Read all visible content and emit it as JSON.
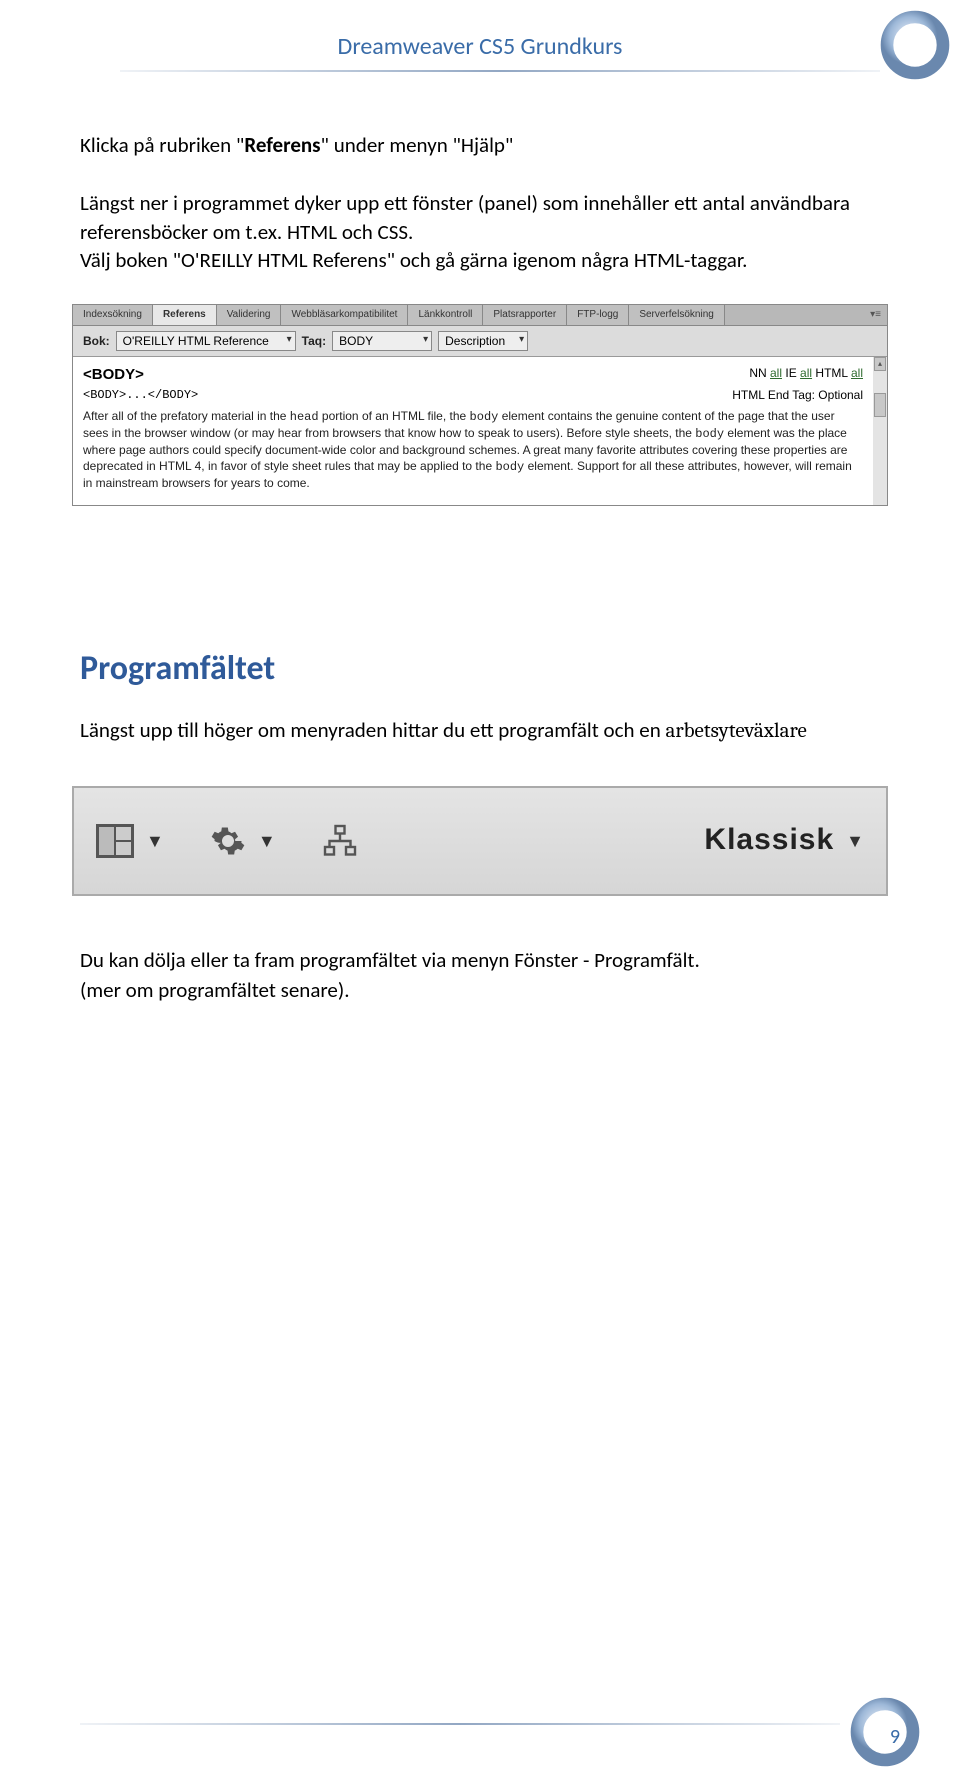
{
  "header": {
    "title": "Dreamweaver CS5 Grundkurs"
  },
  "intro": {
    "line1_a": "Klicka på rubriken \"",
    "line1_bold": "Referens",
    "line1_b": "\" under menyn \"Hjälp\"",
    "para2": "Längst ner i programmet dyker upp ett fönster (panel) som innehåller ett antal användbara referensböcker om t.ex. HTML och CSS.",
    "para3": "Välj boken \"O'REILLY HTML Referens\" och gå gärna igenom några HTML-taggar."
  },
  "panel": {
    "tabs": [
      "Indexsökning",
      "Referens",
      "Validering",
      "Webbläsarkompatibilitet",
      "Länkkontroll",
      "Platsrapporter",
      "FTP-logg",
      "Serverfelsökning"
    ],
    "activeTab": 1,
    "bokLabel": "Bok:",
    "bokValue": "O'REILLY HTML Reference",
    "tagLabel": "Taq:",
    "tagValue": "BODY",
    "descValue": "Description",
    "body": {
      "title": "<BODY>",
      "compat_nn": "NN",
      "compat_ie": "IE",
      "compat_html": "HTML",
      "all": "all",
      "syntax": "<BODY>...</BODY>",
      "endtag": "HTML End Tag: Optional",
      "desc_a": "After all of the prefatory material in the ",
      "desc_head": "head",
      "desc_b": " portion of an HTML file, the ",
      "desc_body": "body",
      "desc_c": " element contains the genuine content of the page that the user sees in the browser window (or may hear from browsers that know how to speak to users). Before style sheets, the ",
      "desc_body2": "body",
      "desc_d": " element was the place where page authors could specify document-wide color and background schemes. A great many favorite attributes covering these properties are deprecated in HTML 4, in favor of style sheet rules that may be applied to the ",
      "desc_body3": "body",
      "desc_e": " element. Support for all these attributes, however, will remain in mainstream browsers for years to come."
    }
  },
  "section2": {
    "heading": "Programfältet",
    "intro_a": "Längst upp till höger om menyraden hittar du ett programfält och en ",
    "intro_b": "arbetsyteväxlare",
    "workspace": "Klassisk",
    "p4": "Du kan dölja eller ta fram programfältet via menyn Fönster - Programfält.",
    "p5": "(mer om programfältet senare)."
  },
  "page": {
    "num": "9"
  }
}
